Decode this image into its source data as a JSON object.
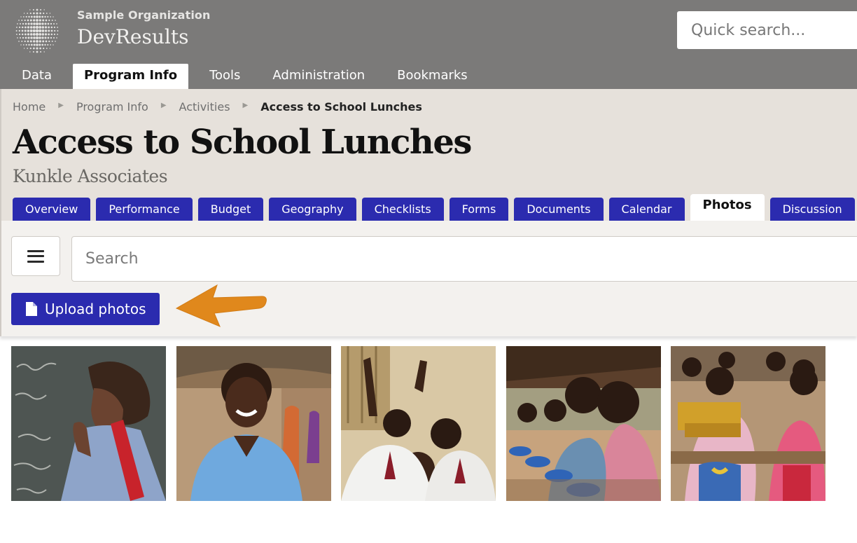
{
  "header": {
    "org_name": "Sample Organization",
    "app_name": "DevResults",
    "quick_search_placeholder": "Quick search..."
  },
  "main_nav": {
    "items": [
      {
        "label": "Data"
      },
      {
        "label": "Program Info",
        "active": true
      },
      {
        "label": "Tools"
      },
      {
        "label": "Administration"
      },
      {
        "label": "Bookmarks"
      }
    ]
  },
  "breadcrumb": {
    "items": [
      "Home",
      "Program Info",
      "Activities"
    ],
    "current": "Access to School Lunches"
  },
  "page": {
    "title": "Access to School Lunches",
    "subtitle": "Kunkle Associates"
  },
  "tabs": [
    {
      "label": "Overview"
    },
    {
      "label": "Performance"
    },
    {
      "label": "Budget"
    },
    {
      "label": "Geography"
    },
    {
      "label": "Checklists"
    },
    {
      "label": "Forms"
    },
    {
      "label": "Documents"
    },
    {
      "label": "Calendar"
    },
    {
      "label": "Photos",
      "active": true
    },
    {
      "label": "Discussion"
    }
  ],
  "toolbar": {
    "menu_icon": "hamburger-icon",
    "search_placeholder": "Search",
    "upload_label": "Upload photos",
    "upload_icon": "file-icon"
  },
  "photos": [
    {
      "subject": "child-writing-on-chalkboard"
    },
    {
      "subject": "smiling-girl-in-blue-uniform"
    },
    {
      "subject": "students-raising-hands"
    },
    {
      "subject": "children-eating-from-blue-bowls"
    },
    {
      "subject": "students-at-wooden-desks"
    }
  ],
  "colors": {
    "header_bg": "#7b7a79",
    "title_bg": "#e6e1db",
    "tab_blue": "#2b2baf",
    "arrow_orange": "#e0881c"
  }
}
